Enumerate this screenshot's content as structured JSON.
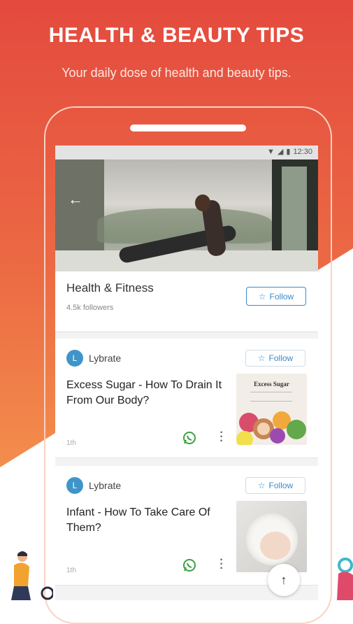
{
  "promo": {
    "title": "HEALTH & BEAUTY TIPS",
    "subtitle": "Your daily dose of health and beauty tips."
  },
  "status_bar": {
    "time": "12:30",
    "icons": [
      "wifi-icon",
      "signal-icon",
      "battery-icon"
    ]
  },
  "topic": {
    "name": "Health & Fitness",
    "followers": "4.5k followers",
    "follow_label": "Follow"
  },
  "posts": [
    {
      "author_initial": "L",
      "author": "Lybrate",
      "follow_label": "Follow",
      "title": "Excess Sugar - How To Drain It From Our Body?",
      "time": "1th",
      "thumb_text": "Excess Sugar"
    },
    {
      "author_initial": "L",
      "author": "Lybrate",
      "follow_label": "Follow",
      "title": "Infant - How To Take Care Of Them?",
      "time": "1th"
    }
  ],
  "colors": {
    "gradient_top": "#e44a3e",
    "gradient_bottom": "#f4a35a",
    "accent_blue": "#3a8bc9",
    "whatsapp_green": "#3aa245"
  }
}
